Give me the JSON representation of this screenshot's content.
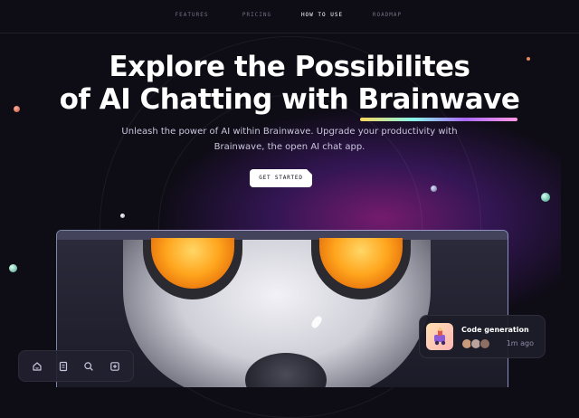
{
  "nav": {
    "items": [
      {
        "label": "FEATURES",
        "active": false
      },
      {
        "label": "PRICING",
        "active": false
      },
      {
        "label": "HOW TO USE",
        "active": true
      },
      {
        "label": "ROADMAP",
        "active": false
      }
    ]
  },
  "hero": {
    "title_line1": "Explore the Possibilites",
    "title_line2_prefix": "of AI Chatting with ",
    "title_brand": "Brainwave",
    "subtitle": "Unleash the power of AI within Brainwave. Upgrade your productivity with Brainwave, the open AI chat app.",
    "cta_label": "GET STARTED"
  },
  "toolbar": {
    "icons": [
      "home-icon",
      "document-icon",
      "search-icon",
      "plus-square-icon"
    ]
  },
  "notification": {
    "title": "Code generation",
    "time": "1m ago",
    "avatar_colors": [
      "#c99b7a",
      "#b9a39a",
      "#8d6f63"
    ]
  },
  "colors": {
    "background": "#0e0c15",
    "accent_gradient": [
      "#f9d65c",
      "#89f9e8",
      "#ac6aff",
      "#ff98e2"
    ],
    "eye_orange": "#ffa51d"
  }
}
